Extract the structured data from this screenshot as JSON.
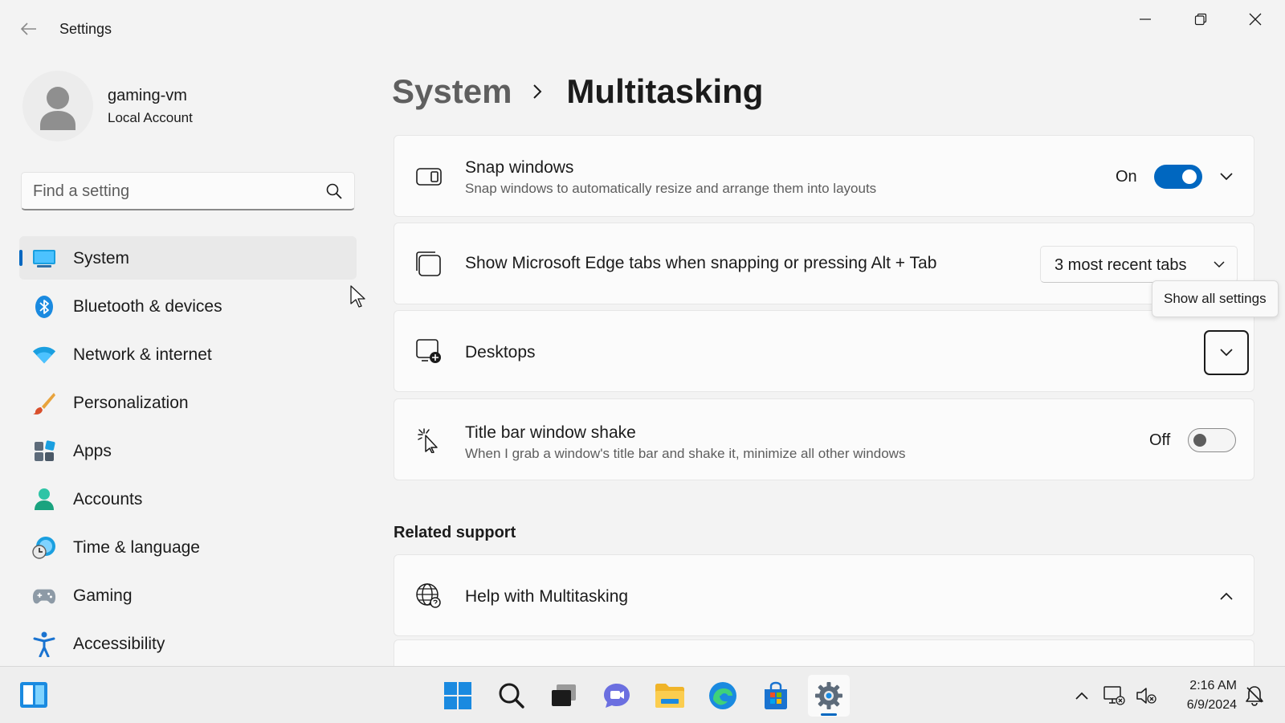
{
  "window": {
    "title": "Settings"
  },
  "profile": {
    "name": "gaming-vm",
    "account_type": "Local Account"
  },
  "search": {
    "placeholder": "Find a setting",
    "value": ""
  },
  "nav": {
    "items": [
      {
        "label": "System",
        "icon": "system-icon",
        "active": true
      },
      {
        "label": "Bluetooth & devices",
        "icon": "bluetooth-icon"
      },
      {
        "label": "Network & internet",
        "icon": "wifi-icon"
      },
      {
        "label": "Personalization",
        "icon": "brush-icon"
      },
      {
        "label": "Apps",
        "icon": "apps-icon"
      },
      {
        "label": "Accounts",
        "icon": "accounts-icon"
      },
      {
        "label": "Time & language",
        "icon": "time-language-icon"
      },
      {
        "label": "Gaming",
        "icon": "gamepad-icon"
      },
      {
        "label": "Accessibility",
        "icon": "accessibility-icon"
      }
    ]
  },
  "breadcrumb": {
    "parent": "System",
    "current": "Multitasking"
  },
  "settings": {
    "snap": {
      "title": "Snap windows",
      "description": "Snap windows to automatically resize and arrange them into layouts",
      "state_label": "On",
      "enabled": true
    },
    "edge_tabs": {
      "title": "Show Microsoft Edge tabs when snapping or pressing Alt + Tab",
      "selected": "3 most recent tabs"
    },
    "desktops": {
      "title": "Desktops"
    },
    "shake": {
      "title": "Title bar window shake",
      "description": "When I grab a window's title bar and shake it, minimize all other windows",
      "state_label": "Off",
      "enabled": false
    }
  },
  "tooltip": {
    "text": "Show all settings"
  },
  "related": {
    "heading": "Related support",
    "help_title": "Help with Multitasking"
  },
  "taskbar": {
    "time": "2:16 AM",
    "date": "6/9/2024"
  },
  "colors": {
    "accent": "#0067c0",
    "background": "#f3f3f3",
    "card": "#fbfbfb"
  }
}
